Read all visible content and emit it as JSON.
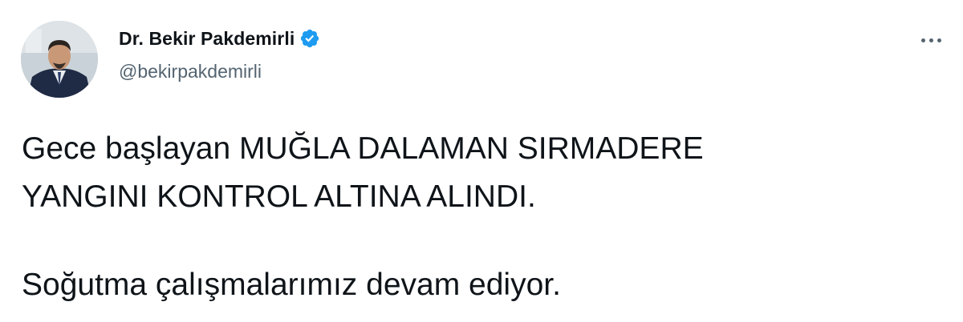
{
  "author": {
    "display_name": "Dr. Bekir Pakdemirli",
    "handle": "@bekirpakdemirli",
    "verified": true,
    "verified_icon": "verified-badge-icon",
    "avatar_icon": "avatar-photo"
  },
  "tweet": {
    "lines": [
      "Gece başlayan MUĞLA DALAMAN SIRMADERE",
      "YANGINI KONTROL ALTINA ALINDI.",
      "Soğutma çalışmalarımız devam ediyor."
    ]
  },
  "colors": {
    "verified_blue": "#1d9bf0",
    "text_primary": "#0f1419",
    "text_secondary": "#536471"
  },
  "menu": {
    "icon": "more-options-icon"
  }
}
